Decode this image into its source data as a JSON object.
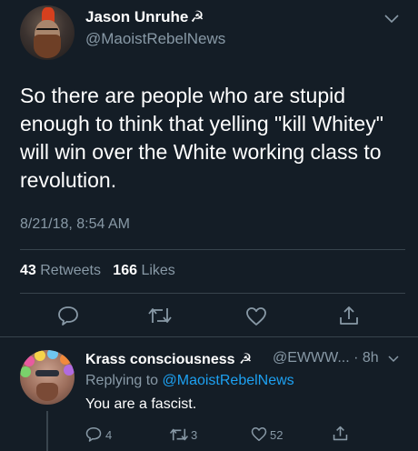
{
  "main_tweet": {
    "author_name": "Jason Unruhe",
    "author_badge": "☭",
    "handle": "@MaoistRebelNews",
    "text": "So there are people who are stupid enough to think that yelling \"kill Whitey\" will win over the White working class to revolution.",
    "timestamp": "8/21/18, 8:54 AM",
    "retweets_count": "43",
    "retweets_label": "Retweets",
    "likes_count": "166",
    "likes_label": "Likes",
    "actions": [
      "reply-icon",
      "retweet-icon",
      "like-icon",
      "share-icon"
    ]
  },
  "reply_tweet": {
    "author_name": "Krass consciousness",
    "author_badge": "☭",
    "meta": "@EWWW... · 8h",
    "replying_prefix": "Replying to",
    "replying_to": "@MaoistRebelNews",
    "text": "You are a fascist.",
    "reply_count": "4",
    "retweet_count": "3",
    "like_count": "52"
  },
  "colors": {
    "background": "#141d26",
    "secondary_text": "#8899a6",
    "link": "#1da1f2",
    "divider": "#38444d"
  }
}
